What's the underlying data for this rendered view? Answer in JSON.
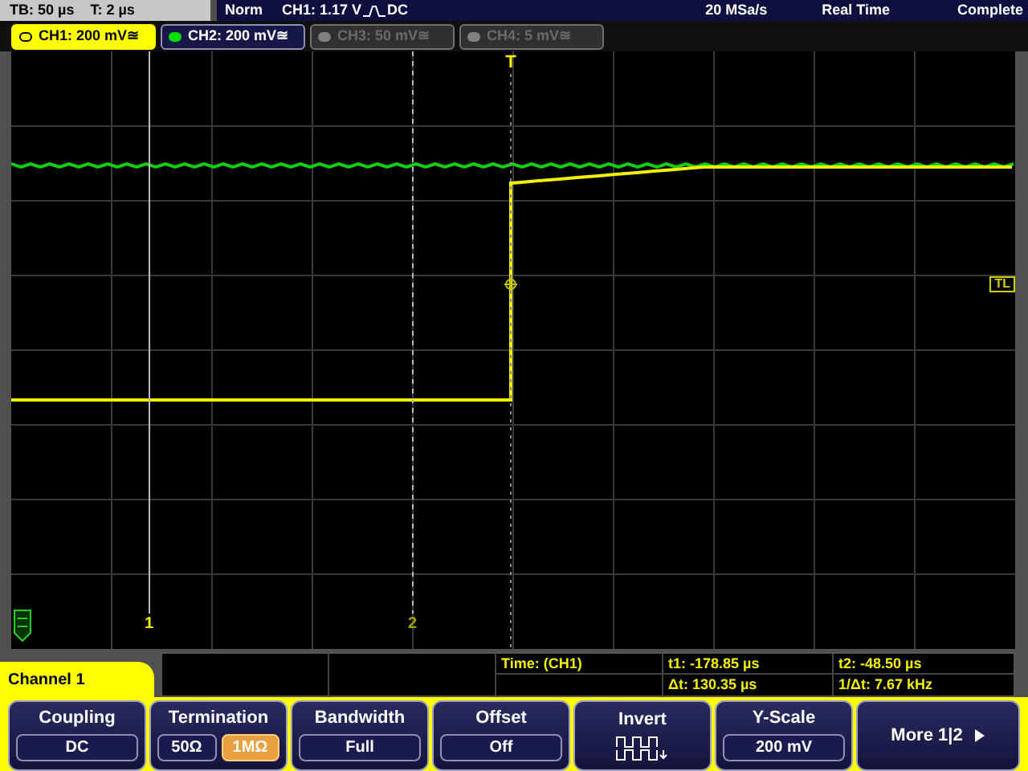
{
  "status_bar": {
    "timebase": "TB: 50 µs",
    "trigger_pos": "T: 2 µs",
    "mode": "Norm",
    "trigger_source": "CH1: 1.17 V",
    "trigger_coupling": "DC",
    "sample_rate": "20 MSa/s",
    "acquisition": "Real Time",
    "state": "Complete"
  },
  "channel_tabs": [
    {
      "label": "CH1: 200 mV",
      "coupling_symbol": "≊",
      "selected": true,
      "enabled": true,
      "color": "#ffff00"
    },
    {
      "label": "CH2: 200 mV",
      "coupling_symbol": "≊",
      "selected": false,
      "enabled": true,
      "color": "#00e000"
    },
    {
      "label": "CH3: 50 mV",
      "coupling_symbol": "≊",
      "selected": false,
      "enabled": false,
      "color": "#808080"
    },
    {
      "label": "CH4: 5 mV",
      "coupling_symbol": "≊",
      "selected": false,
      "enabled": false,
      "color": "#808080"
    }
  ],
  "plot": {
    "trigger_marker": "T",
    "trigger_level_marker": "TL",
    "cursor_labels": [
      "1",
      "2"
    ]
  },
  "measurement": {
    "title": "Time:  (CH1)",
    "t1": "t1: -178.85 µs",
    "t2": "t2: -48.50 µs",
    "dt": "Δt: 130.35 µs",
    "inv_dt": "1/Δt: 7.67 kHz"
  },
  "menu": {
    "title": "Channel 1",
    "softkeys": [
      {
        "kind": "value",
        "label": "Coupling",
        "value": "DC"
      },
      {
        "kind": "toggle",
        "label": "Termination",
        "options": [
          {
            "label": "50Ω",
            "selected": false
          },
          {
            "label": "1MΩ",
            "selected": true
          }
        ]
      },
      {
        "kind": "value",
        "label": "Bandwidth",
        "value": "Full"
      },
      {
        "kind": "value",
        "label": "Offset",
        "value": "Off"
      },
      {
        "kind": "icon",
        "label": "Invert"
      },
      {
        "kind": "value",
        "label": "Y-Scale",
        "value": "200 mV"
      },
      {
        "kind": "more",
        "label": "More 1|2"
      }
    ]
  }
}
